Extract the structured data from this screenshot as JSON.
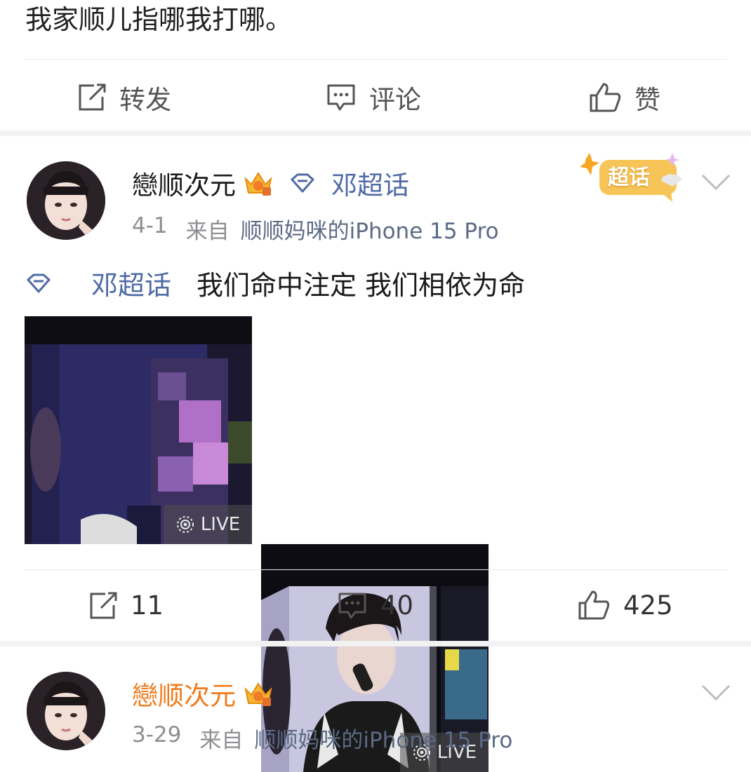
{
  "top_post": {
    "text": "我家顺儿指哪我打哪。",
    "actions": {
      "repost": "转发",
      "comment": "评论",
      "like": "赞"
    }
  },
  "post": {
    "username": "戀顺次元",
    "verified_tag": "邓超话",
    "date": "4-1",
    "source_prefix": "来自",
    "source": "顺顺妈咪的iPhone 15 Pro",
    "topic": "邓超话",
    "text": "我们命中注定 我们相依为命",
    "super_badge": "超话",
    "live_label": "LIVE",
    "counts": {
      "repost": "11",
      "comment": "40",
      "like": "425"
    }
  },
  "next_post": {
    "username": "戀顺次元",
    "date": "3-29",
    "source_prefix": "来自",
    "source": "顺顺妈咪的iPhone 15 Pro"
  },
  "colors": {
    "link": "#4e6aa6",
    "orange_name": "#f27a1a",
    "meta": "#8e8e93"
  },
  "icons": [
    "repost-icon",
    "comment-icon",
    "like-icon",
    "crown-icon",
    "diamond-icon",
    "chevron-down-icon",
    "live-icon"
  ]
}
